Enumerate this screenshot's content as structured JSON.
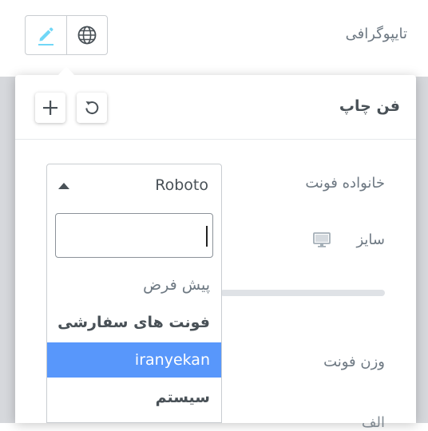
{
  "control": {
    "label": "تایپوگرافی",
    "edit_icon": "pencil-icon",
    "global_icon": "globe-icon"
  },
  "popover": {
    "title": "فن چاپ",
    "reset_icon": "reset-icon",
    "add_icon": "plus-icon"
  },
  "fields": {
    "font_family_label": "خانواده فونت",
    "size_label": "سایز",
    "size_device_icon": "desktop-icon",
    "weight_label": "وزن فونت"
  },
  "select": {
    "value": "Roboto",
    "search_value": "",
    "options": [
      {
        "label": "پیش فرض",
        "kind": "plain"
      },
      {
        "label": "فونت های سفارشی",
        "kind": "group"
      },
      {
        "label": "iranyekan",
        "kind": "selected"
      },
      {
        "label": "سیستم",
        "kind": "group"
      }
    ]
  },
  "colors": {
    "highlight": "#5897fb",
    "edit_icon": "#71d7f7"
  }
}
